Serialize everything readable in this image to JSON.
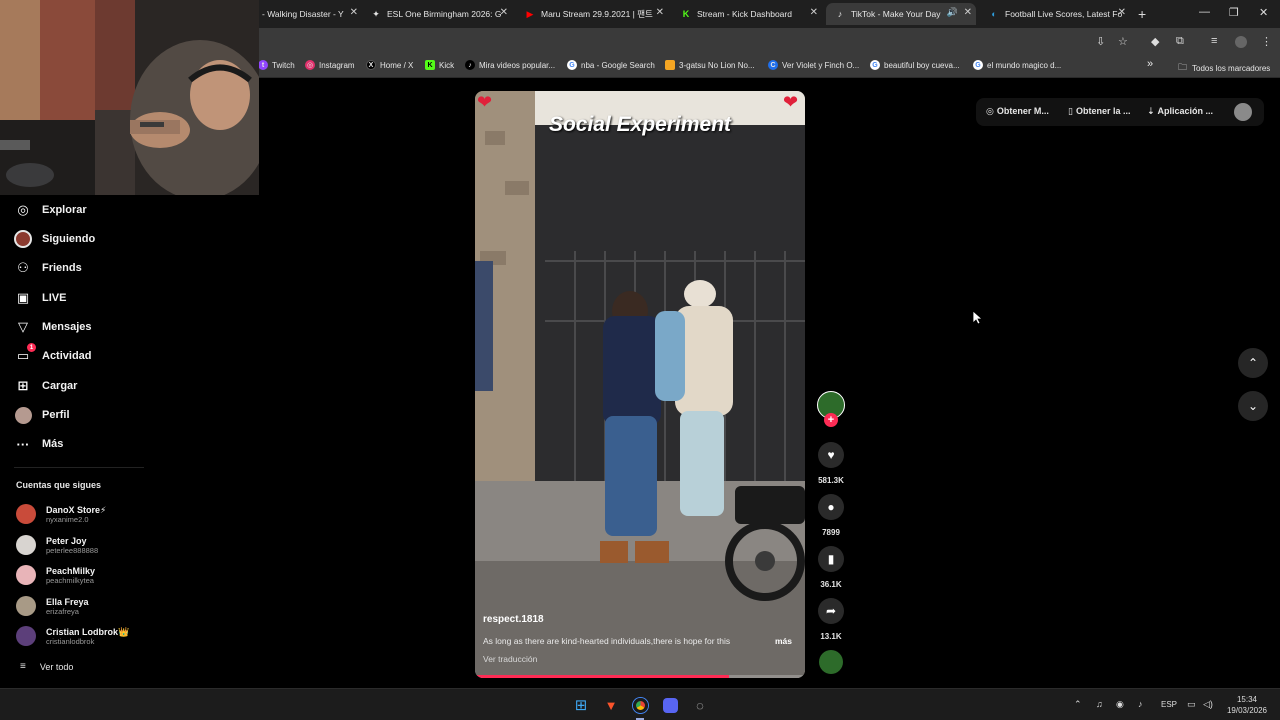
{
  "browser": {
    "tabs": [
      {
        "label": "- Walking Disaster - Y",
        "active": false
      },
      {
        "label": "ESL One Birmingham 2026: G",
        "active": false
      },
      {
        "label": "Maru Stream 29.9.2021 | 팬트",
        "active": false
      },
      {
        "label": "Stream - Kick Dashboard",
        "active": false
      },
      {
        "label": "TikTok - Make Your Day",
        "active": true
      },
      {
        "label": "Football Live Scores, Latest Fo",
        "active": false
      }
    ],
    "new_tab": "+",
    "bookmarks": [
      {
        "label": "Twitch",
        "icon": "twitch-icon",
        "color": "#9146ff",
        "glyph": "t"
      },
      {
        "label": "Instagram",
        "icon": "instagram-icon",
        "color": "#e1306c",
        "glyph": "◎"
      },
      {
        "label": "Home / X",
        "icon": "x-icon",
        "color": "#000000",
        "glyph": "X"
      },
      {
        "label": "Kick",
        "icon": "kick-icon",
        "color": "#53fc18",
        "glyph": "K"
      },
      {
        "label": "Mira videos popular...",
        "icon": "tiktok-icon",
        "color": "#000000",
        "glyph": "♪"
      },
      {
        "label": "nba - Google Search",
        "icon": "google-icon",
        "color": "#ffffff",
        "glyph": "G"
      },
      {
        "label": "3-gatsu No Lion No...",
        "icon": "bookmark-icon",
        "color": "#f5a623",
        "glyph": "■"
      },
      {
        "label": "Ver Violet y Finch O...",
        "icon": "bookmark-icon",
        "color": "#1f6feb",
        "glyph": "C"
      },
      {
        "label": "beautiful boy cueva...",
        "icon": "google-icon",
        "color": "#ffffff",
        "glyph": "G"
      },
      {
        "label": "el mundo magico d...",
        "icon": "google-icon",
        "color": "#ffffff",
        "glyph": "G"
      }
    ],
    "bookmarks_overflow": "»",
    "all_bookmarks": "Todos los marcadores"
  },
  "sidebar": {
    "items": [
      {
        "label": "Explorar",
        "icon": "compass-icon",
        "glyph": "◎"
      },
      {
        "label": "Siguiendo",
        "icon": "following-avatar-icon",
        "glyph": "●"
      },
      {
        "label": "Friends",
        "icon": "friends-icon",
        "glyph": "⚇"
      },
      {
        "label": "LIVE",
        "icon": "live-icon",
        "glyph": "▣"
      },
      {
        "label": "Mensajes",
        "icon": "messages-icon",
        "glyph": "▽"
      },
      {
        "label": "Actividad",
        "icon": "activity-icon",
        "glyph": "▭",
        "badge": "1"
      },
      {
        "label": "Cargar",
        "icon": "upload-icon",
        "glyph": "⊞"
      },
      {
        "label": "Perfil",
        "icon": "profile-avatar-icon",
        "glyph": "●"
      },
      {
        "label": "Más",
        "icon": "more-icon",
        "glyph": "···"
      }
    ],
    "following_title": "Cuentas que sigues",
    "following": [
      {
        "name": "DanoX Store⚡",
        "user": "nyxanime2.0",
        "color": "#c94b3a"
      },
      {
        "name": "Peter Joy",
        "user": "peterlee888888",
        "color": "#d8d4d0"
      },
      {
        "name": "PeachMilky",
        "user": "peachmilkytea",
        "color": "#e8b4b8"
      },
      {
        "name": "Ella Freya",
        "user": "erizafreya",
        "color": "#a89a86"
      },
      {
        "name": "Cristian Lodbrok👑",
        "user": "cristianlodbrok",
        "color": "#5c3f7a"
      }
    ],
    "see_all": "Ver todo"
  },
  "video": {
    "title": "Social  Experiment",
    "author": "respect.1818",
    "description": "As long as there are kind-hearted individuals,there is hope for this",
    "more": "más",
    "translate": "Ver traducción",
    "progress": 0.77
  },
  "actions": {
    "likes": "581.3K",
    "comments": "7899",
    "saves": "36.1K",
    "shares": "13.1K"
  },
  "topbar": {
    "coins": "Obtener M...",
    "app": "Obtener la ...",
    "download": "Aplicación ..."
  },
  "taskbar": {
    "language": "ESP",
    "time": "15:34",
    "date": "19/03/2026"
  }
}
